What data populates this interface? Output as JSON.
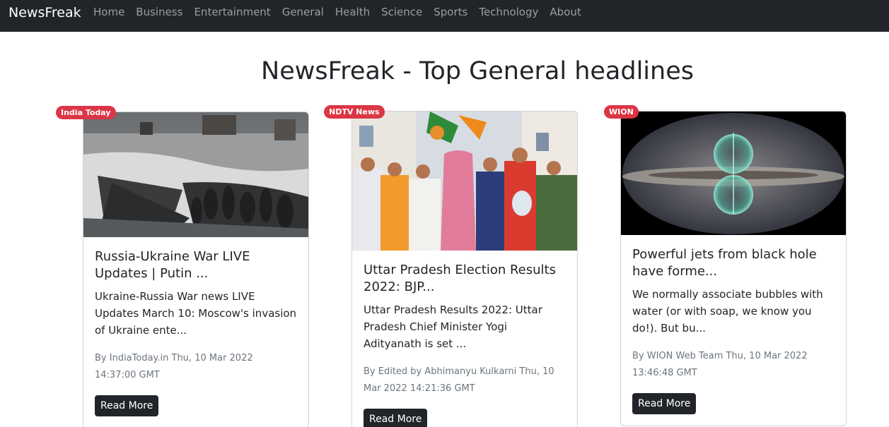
{
  "navbar": {
    "brand": "NewsFreak",
    "links": [
      "Home",
      "Business",
      "Entertainment",
      "General",
      "Health",
      "Science",
      "Sports",
      "Technology",
      "About"
    ]
  },
  "page": {
    "title": "NewsFreak - Top General headlines"
  },
  "articles": [
    {
      "source": "India Today",
      "title": "Russia-Ukraine War LIVE Updates | Putin ...",
      "description": "Ukraine-Russia War news LIVE Updates March 10: Moscow's invasion of Ukraine ente...",
      "meta": "By IndiaToday.in Thu, 10 Mar 2022 14:37:00 GMT",
      "button": "Read More",
      "image": "war-ruins-photo"
    },
    {
      "source": "NDTV News",
      "title": "Uttar Pradesh Election Results 2022: BJP...",
      "description": "Uttar Pradesh Results 2022: Uttar Pradesh Chief Minister Yogi Adityanath is set ...",
      "meta": "By Edited by Abhimanyu Kulkarni Thu, 10 Mar 2022 14:21:36 GMT",
      "button": "Read More",
      "image": "election-celebration-photo"
    },
    {
      "source": "WION",
      "title": "Powerful jets from black hole have forme...",
      "description": "We normally associate bubbles with water (or with soap, we know you do!). But bu...",
      "meta": "By WION Web Team Thu, 10 Mar 2022 13:46:48 GMT",
      "button": "Read More",
      "image": "galaxy-bubbles-photo"
    }
  ],
  "colors": {
    "navbar": "#212529",
    "badge": "#dc3545",
    "button": "#212529",
    "muted": "#6c757d"
  }
}
